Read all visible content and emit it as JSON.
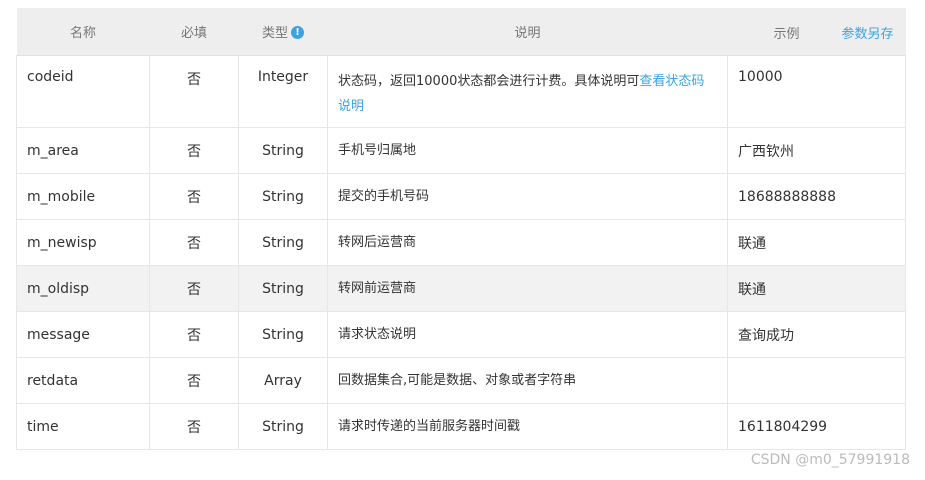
{
  "header": {
    "name": "名称",
    "required": "必填",
    "type": "类型",
    "info_icon": "info-icon",
    "desc": "说明",
    "example": "示例",
    "save_params": "参数另存"
  },
  "rows": [
    {
      "name": "codeid",
      "required": "否",
      "type": "Integer",
      "desc_text": "状态码，返回10000状态都会进行计费。具体说明可",
      "desc_link": "查看状态码说明",
      "example": "10000"
    },
    {
      "name": "m_area",
      "required": "否",
      "type": "String",
      "desc_text": "手机号归属地",
      "example": "广西钦州"
    },
    {
      "name": "m_mobile",
      "required": "否",
      "type": "String",
      "desc_text": "提交的手机号码",
      "example": "18688888888"
    },
    {
      "name": "m_newisp",
      "required": "否",
      "type": "String",
      "desc_text": "转网后运营商",
      "example": "联通"
    },
    {
      "name": "m_oldisp",
      "required": "否",
      "type": "String",
      "desc_text": "转网前运营商",
      "example": "联通"
    },
    {
      "name": "message",
      "required": "否",
      "type": "String",
      "desc_text": "请求状态说明",
      "example": "查询成功"
    },
    {
      "name": "retdata",
      "required": "否",
      "type": "Array",
      "desc_text": "回数据集合,可能是数据、对象或者字符串",
      "example": ""
    },
    {
      "name": "time",
      "required": "否",
      "type": "String",
      "desc_text": "请求时传递的当前服务器时间戳",
      "example": "1611804299"
    }
  ],
  "watermark": "CSDN @m0_57991918",
  "colors": {
    "link": "#3aa4e0",
    "header_bg": "#eeeeee",
    "highlight_row": "#f2f2f2"
  }
}
